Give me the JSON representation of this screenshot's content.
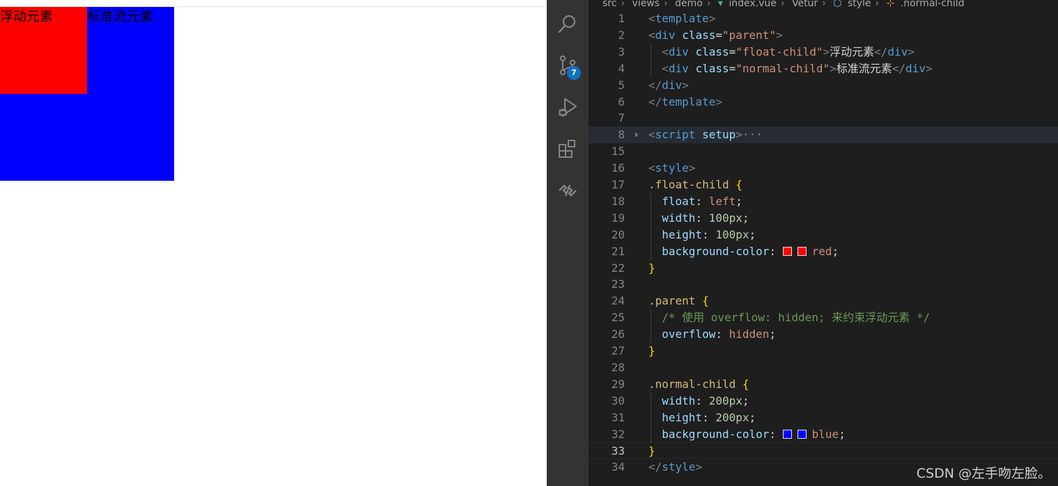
{
  "preview": {
    "float_child_text": "浮动元素",
    "normal_child_text": "标准流元素",
    "colors": {
      "float_bg": "#ff0000",
      "normal_bg": "#0000ff"
    }
  },
  "activity_bar": {
    "items": [
      {
        "icon": "search-icon"
      },
      {
        "icon": "source-control-icon",
        "badge": "7"
      },
      {
        "icon": "run-debug-icon"
      },
      {
        "icon": "extensions-icon"
      },
      {
        "icon": "remote-icon"
      }
    ]
  },
  "breadcrumb": [
    "src",
    "views",
    "demo",
    "index.vue",
    "Vetur",
    "style",
    ".normal-child"
  ],
  "editor": {
    "accent_colors": {
      "background": "#1e1e1e",
      "activity_bar": "#333333",
      "badge": "#0e70c0"
    },
    "lines": [
      {
        "n": "1",
        "segs": [
          [
            "brk",
            "<"
          ],
          [
            "tag",
            "template"
          ],
          [
            "brk",
            ">"
          ]
        ]
      },
      {
        "n": "2",
        "segs": [
          [
            "brk",
            "<"
          ],
          [
            "tag",
            "div"
          ],
          [
            "plain",
            " "
          ],
          [
            "attr",
            "class"
          ],
          [
            "plain",
            "="
          ],
          [
            "str",
            "\"parent\""
          ],
          [
            "brk",
            ">"
          ]
        ]
      },
      {
        "n": "3",
        "guide": true,
        "segs": [
          [
            "plain",
            "  "
          ],
          [
            "brk",
            "<"
          ],
          [
            "tag",
            "div"
          ],
          [
            "plain",
            " "
          ],
          [
            "attr",
            "class"
          ],
          [
            "plain",
            "="
          ],
          [
            "str",
            "\"float-child\""
          ],
          [
            "brk",
            ">"
          ],
          [
            "plain",
            "浮动元素"
          ],
          [
            "brk",
            "</"
          ],
          [
            "tag",
            "div"
          ],
          [
            "brk",
            ">"
          ]
        ]
      },
      {
        "n": "4",
        "guide": true,
        "segs": [
          [
            "plain",
            "  "
          ],
          [
            "brk",
            "<"
          ],
          [
            "tag",
            "div"
          ],
          [
            "plain",
            " "
          ],
          [
            "attr",
            "class"
          ],
          [
            "plain",
            "="
          ],
          [
            "str",
            "\"normal-child\""
          ],
          [
            "brk",
            ">"
          ],
          [
            "plain",
            "标准流元素"
          ],
          [
            "brk",
            "</"
          ],
          [
            "tag",
            "div"
          ],
          [
            "brk",
            ">"
          ]
        ]
      },
      {
        "n": "5",
        "segs": [
          [
            "brk",
            "</"
          ],
          [
            "tag",
            "div"
          ],
          [
            "brk",
            ">"
          ]
        ]
      },
      {
        "n": "6",
        "segs": [
          [
            "brk",
            "</"
          ],
          [
            "tag",
            "template"
          ],
          [
            "brk",
            ">"
          ]
        ]
      },
      {
        "n": "7",
        "segs": []
      },
      {
        "n": "8",
        "fold": "›",
        "hl": true,
        "segs": [
          [
            "brk",
            "<"
          ],
          [
            "tag",
            "script"
          ],
          [
            "plain",
            " "
          ],
          [
            "attr",
            "setup"
          ],
          [
            "brk",
            ">"
          ],
          [
            "brk",
            "···"
          ]
        ]
      },
      {
        "n": "15",
        "segs": []
      },
      {
        "n": "16",
        "segs": [
          [
            "brk",
            "<"
          ],
          [
            "tag",
            "style"
          ],
          [
            "brk",
            ">"
          ]
        ]
      },
      {
        "n": "17",
        "segs": [
          [
            "sel",
            ".float-child"
          ],
          [
            "plain",
            " "
          ],
          [
            "brace",
            "{"
          ]
        ]
      },
      {
        "n": "18",
        "guide": true,
        "segs": [
          [
            "plain",
            "  "
          ],
          [
            "prop",
            "float"
          ],
          [
            "plain",
            ": "
          ],
          [
            "val",
            "left"
          ],
          [
            "plain",
            ";"
          ]
        ]
      },
      {
        "n": "19",
        "guide": true,
        "segs": [
          [
            "plain",
            "  "
          ],
          [
            "prop",
            "width"
          ],
          [
            "plain",
            ": "
          ],
          [
            "num",
            "100px"
          ],
          [
            "plain",
            ";"
          ]
        ]
      },
      {
        "n": "20",
        "guide": true,
        "segs": [
          [
            "plain",
            "  "
          ],
          [
            "prop",
            "height"
          ],
          [
            "plain",
            ": "
          ],
          [
            "num",
            "100px"
          ],
          [
            "plain",
            ";"
          ]
        ]
      },
      {
        "n": "21",
        "guide": true,
        "segs": [
          [
            "plain",
            "  "
          ],
          [
            "prop",
            "background-color"
          ],
          [
            "plain",
            ": "
          ],
          [
            "swatch",
            "#ff0000"
          ],
          [
            "swatch",
            "#ff0000"
          ],
          [
            "val",
            "red"
          ],
          [
            "plain",
            ";"
          ]
        ]
      },
      {
        "n": "22",
        "segs": [
          [
            "brace",
            "}"
          ]
        ]
      },
      {
        "n": "23",
        "segs": []
      },
      {
        "n": "24",
        "segs": [
          [
            "sel",
            ".parent"
          ],
          [
            "plain",
            " "
          ],
          [
            "brace",
            "{"
          ]
        ]
      },
      {
        "n": "25",
        "guide": true,
        "segs": [
          [
            "plain",
            "  "
          ],
          [
            "cmt",
            "/* 使用 overflow: hidden; 来约束浮动元素 */"
          ]
        ]
      },
      {
        "n": "26",
        "guide": true,
        "segs": [
          [
            "plain",
            "  "
          ],
          [
            "prop",
            "overflow"
          ],
          [
            "plain",
            ": "
          ],
          [
            "val",
            "hidden"
          ],
          [
            "plain",
            ";"
          ]
        ]
      },
      {
        "n": "27",
        "segs": [
          [
            "brace",
            "}"
          ]
        ]
      },
      {
        "n": "28",
        "segs": []
      },
      {
        "n": "29",
        "segs": [
          [
            "sel",
            ".normal-child"
          ],
          [
            "plain",
            " "
          ],
          [
            "brace",
            "{"
          ]
        ]
      },
      {
        "n": "30",
        "guide": true,
        "segs": [
          [
            "plain",
            "  "
          ],
          [
            "prop",
            "width"
          ],
          [
            "plain",
            ": "
          ],
          [
            "num",
            "200px"
          ],
          [
            "plain",
            ";"
          ]
        ]
      },
      {
        "n": "31",
        "guide": true,
        "segs": [
          [
            "plain",
            "  "
          ],
          [
            "prop",
            "height"
          ],
          [
            "plain",
            ": "
          ],
          [
            "num",
            "200px"
          ],
          [
            "plain",
            ";"
          ]
        ]
      },
      {
        "n": "32",
        "guide": true,
        "segs": [
          [
            "plain",
            "  "
          ],
          [
            "prop",
            "background-color"
          ],
          [
            "plain",
            ": "
          ],
          [
            "swatch",
            "#0000ff"
          ],
          [
            "swatch",
            "#0000ff"
          ],
          [
            "val",
            "blue"
          ],
          [
            "plain",
            ";"
          ]
        ]
      },
      {
        "n": "33",
        "active": true,
        "segs": [
          [
            "brace",
            "}"
          ]
        ]
      },
      {
        "n": "34",
        "segs": [
          [
            "brk",
            "</"
          ],
          [
            "tag",
            "style"
          ],
          [
            "brk",
            ">"
          ]
        ]
      }
    ]
  },
  "watermark": "CSDN @左手吻左脸。"
}
